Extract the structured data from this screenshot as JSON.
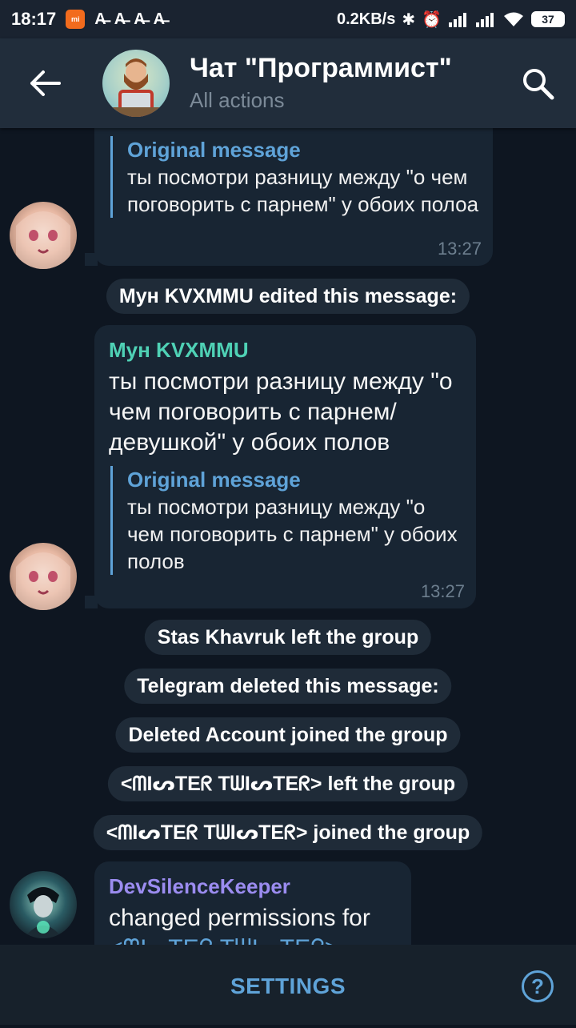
{
  "status_bar": {
    "time": "18:17",
    "mi_label": "mi",
    "notifications": [
      "A̶",
      "A̶",
      "A̶",
      "A̶"
    ],
    "net_speed": "0.2KB/s",
    "battery": "37"
  },
  "header": {
    "title": "Чат \"Программист\"",
    "subtitle": "All actions"
  },
  "messages": [
    {
      "quote_title": "Original message",
      "quote_text": "ты посмотри разницу между \"о чем поговорить с парнем\" у обоих полоа",
      "time": "13:27"
    },
    {
      "service": "Мун KVXMMU edited this message:"
    },
    {
      "sender": "Мун KVXMMU",
      "text": "ты посмотри разницу между \"о чем поговорить с парнем/девушкой\" у обоих полов",
      "quote_title": "Original message",
      "quote_text": "ты посмотри разницу между \"о чем поговорить с парнем\" у обоих полов",
      "time": "13:27"
    },
    {
      "service": "Stas Khavruk left the group"
    },
    {
      "service": "Telegram deleted this message:"
    },
    {
      "service": "Deleted Account joined the group"
    },
    {
      "service": "<ᗰIᔕTEᖇ TᗯIᔕTEᖇ> left the group"
    },
    {
      "service": "<ᗰIᔕTEᖇ TᗯIᔕTEᖇ> joined the group"
    },
    {
      "sender": "DevSilenceKeeper",
      "text": "changed permissions for",
      "text_cut": "<ᗰIᔕTEᖇ TᗯIᔕTEᖇ>"
    }
  ],
  "bottom": {
    "settings_label": "SETTINGS",
    "help_label": "?"
  },
  "colors": {
    "background": "#0e1621",
    "header": "#212d3b",
    "bubble": "#182533",
    "accent": "#5fa3d8",
    "sender_green": "#4fd1b5",
    "sender_purple": "#9b8cf0"
  }
}
